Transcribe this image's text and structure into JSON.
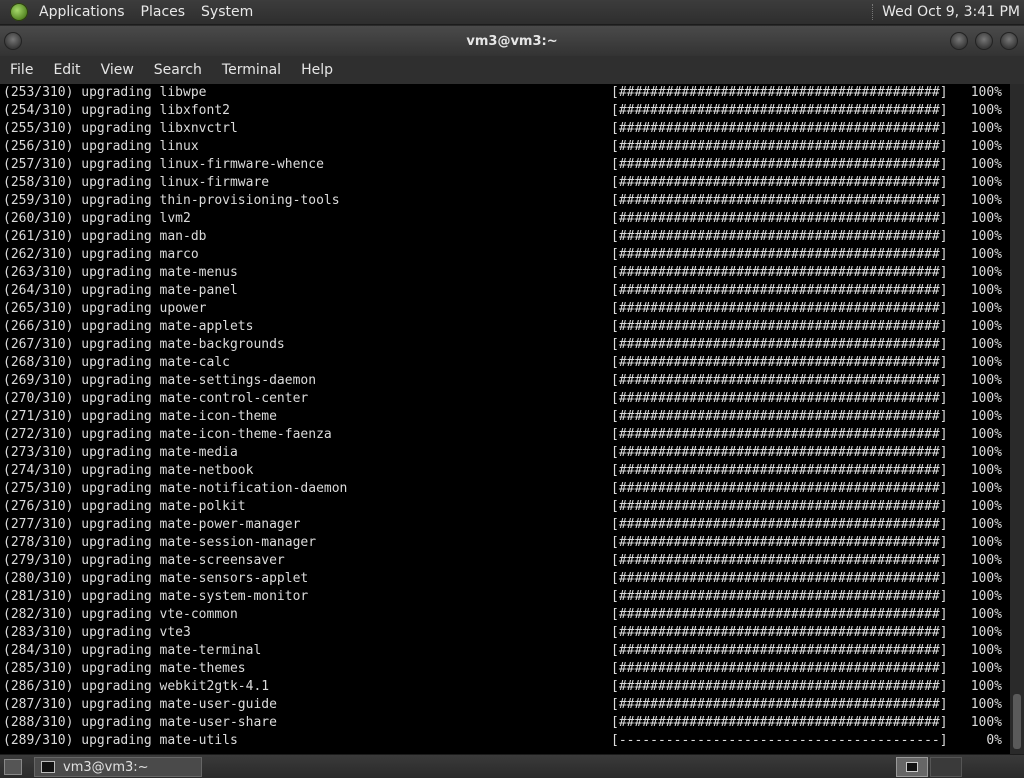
{
  "top_panel": {
    "menus": [
      "Applications",
      "Places",
      "System"
    ],
    "clock": "Wed Oct  9,  3:41 PM"
  },
  "window": {
    "title": "vm3@vm3:~"
  },
  "menubar": [
    "File",
    "Edit",
    "View",
    "Search",
    "Terminal",
    "Help"
  ],
  "terminal": {
    "lines": [
      {
        "text": "(253/310) upgrading libwpe",
        "bar": "[#########################################]",
        "pct": "100%"
      },
      {
        "text": "(254/310) upgrading libxfont2",
        "bar": "[#########################################]",
        "pct": "100%"
      },
      {
        "text": "(255/310) upgrading libxnvctrl",
        "bar": "[#########################################]",
        "pct": "100%"
      },
      {
        "text": "(256/310) upgrading linux",
        "bar": "[#########################################]",
        "pct": "100%"
      },
      {
        "text": "(257/310) upgrading linux-firmware-whence",
        "bar": "[#########################################]",
        "pct": "100%"
      },
      {
        "text": "(258/310) upgrading linux-firmware",
        "bar": "[#########################################]",
        "pct": "100%"
      },
      {
        "text": "(259/310) upgrading thin-provisioning-tools",
        "bar": "[#########################################]",
        "pct": "100%"
      },
      {
        "text": "(260/310) upgrading lvm2",
        "bar": "[#########################################]",
        "pct": "100%"
      },
      {
        "text": "(261/310) upgrading man-db",
        "bar": "[#########################################]",
        "pct": "100%"
      },
      {
        "text": "(262/310) upgrading marco",
        "bar": "[#########################################]",
        "pct": "100%"
      },
      {
        "text": "(263/310) upgrading mate-menus",
        "bar": "[#########################################]",
        "pct": "100%"
      },
      {
        "text": "(264/310) upgrading mate-panel",
        "bar": "[#########################################]",
        "pct": "100%"
      },
      {
        "text": "(265/310) upgrading upower",
        "bar": "[#########################################]",
        "pct": "100%"
      },
      {
        "text": "(266/310) upgrading mate-applets",
        "bar": "[#########################################]",
        "pct": "100%"
      },
      {
        "text": "(267/310) upgrading mate-backgrounds",
        "bar": "[#########################################]",
        "pct": "100%"
      },
      {
        "text": "(268/310) upgrading mate-calc",
        "bar": "[#########################################]",
        "pct": "100%"
      },
      {
        "text": "(269/310) upgrading mate-settings-daemon",
        "bar": "[#########################################]",
        "pct": "100%"
      },
      {
        "text": "(270/310) upgrading mate-control-center",
        "bar": "[#########################################]",
        "pct": "100%"
      },
      {
        "text": "(271/310) upgrading mate-icon-theme",
        "bar": "[#########################################]",
        "pct": "100%"
      },
      {
        "text": "(272/310) upgrading mate-icon-theme-faenza",
        "bar": "[#########################################]",
        "pct": "100%"
      },
      {
        "text": "(273/310) upgrading mate-media",
        "bar": "[#########################################]",
        "pct": "100%"
      },
      {
        "text": "(274/310) upgrading mate-netbook",
        "bar": "[#########################################]",
        "pct": "100%"
      },
      {
        "text": "(275/310) upgrading mate-notification-daemon",
        "bar": "[#########################################]",
        "pct": "100%"
      },
      {
        "text": "(276/310) upgrading mate-polkit",
        "bar": "[#########################################]",
        "pct": "100%"
      },
      {
        "text": "(277/310) upgrading mate-power-manager",
        "bar": "[#########################################]",
        "pct": "100%"
      },
      {
        "text": "(278/310) upgrading mate-session-manager",
        "bar": "[#########################################]",
        "pct": "100%"
      },
      {
        "text": "(279/310) upgrading mate-screensaver",
        "bar": "[#########################################]",
        "pct": "100%"
      },
      {
        "text": "(280/310) upgrading mate-sensors-applet",
        "bar": "[#########################################]",
        "pct": "100%"
      },
      {
        "text": "(281/310) upgrading mate-system-monitor",
        "bar": "[#########################################]",
        "pct": "100%"
      },
      {
        "text": "(282/310) upgrading vte-common",
        "bar": "[#########################################]",
        "pct": "100%"
      },
      {
        "text": "(283/310) upgrading vte3",
        "bar": "[#########################################]",
        "pct": "100%"
      },
      {
        "text": "(284/310) upgrading mate-terminal",
        "bar": "[#########################################]",
        "pct": "100%"
      },
      {
        "text": "(285/310) upgrading mate-themes",
        "bar": "[#########################################]",
        "pct": "100%"
      },
      {
        "text": "(286/310) upgrading webkit2gtk-4.1",
        "bar": "[#########################################]",
        "pct": "100%"
      },
      {
        "text": "(287/310) upgrading mate-user-guide",
        "bar": "[#########################################]",
        "pct": "100%"
      },
      {
        "text": "(288/310) upgrading mate-user-share",
        "bar": "[#########################################]",
        "pct": "100%"
      },
      {
        "text": "(289/310) upgrading mate-utils",
        "bar": "[-----------------------------------------]",
        "pct": "0%"
      }
    ]
  },
  "bottom_panel": {
    "task_label": "vm3@vm3:~"
  }
}
